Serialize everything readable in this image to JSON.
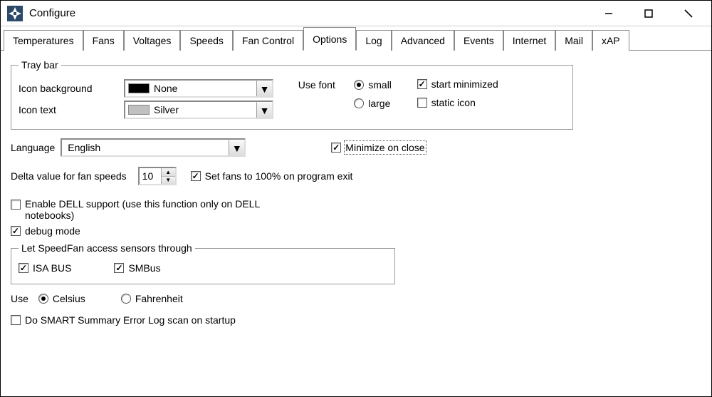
{
  "window": {
    "title": "Configure"
  },
  "tabs": [
    "Temperatures",
    "Fans",
    "Voltages",
    "Speeds",
    "Fan Control",
    "Options",
    "Log",
    "Advanced",
    "Events",
    "Internet",
    "Mail",
    "xAP"
  ],
  "active_tab": "Options",
  "traybar": {
    "legend": "Tray bar",
    "icon_background_label": "Icon background",
    "icon_background_value": "None",
    "icon_background_swatch": "#000000",
    "icon_text_label": "Icon text",
    "icon_text_value": "Silver",
    "icon_text_swatch": "#c0c0c0",
    "use_font_label": "Use font",
    "font_small": "small",
    "font_large": "large",
    "font_selected": "small",
    "start_minimized_label": "start minimized",
    "start_minimized_checked": true,
    "static_icon_label": "static icon",
    "static_icon_checked": false
  },
  "language": {
    "label": "Language",
    "value": "English"
  },
  "minimize_on_close": {
    "label": "Minimize on close",
    "checked": true
  },
  "delta": {
    "label": "Delta value for fan speeds",
    "value": "10"
  },
  "set_fans_exit": {
    "label": "Set fans to 100% on program exit",
    "checked": true
  },
  "dell": {
    "label": "Enable DELL support (use this function only on DELL notebooks)",
    "checked": false
  },
  "debug": {
    "label": "debug mode",
    "checked": true
  },
  "sensors": {
    "legend": "Let SpeedFan access sensors through",
    "isa_label": "ISA BUS",
    "isa_checked": true,
    "smbus_label": "SMBus",
    "smbus_checked": true
  },
  "tempunit": {
    "label": "Use",
    "celsius": "Celsius",
    "fahrenheit": "Fahrenheit",
    "selected": "Celsius"
  },
  "smart": {
    "label": "Do SMART Summary Error Log scan on startup",
    "checked": false
  }
}
